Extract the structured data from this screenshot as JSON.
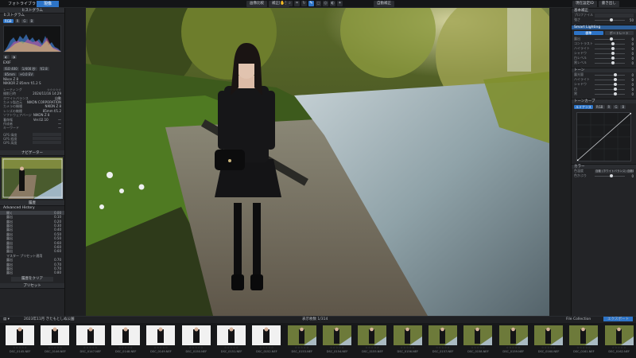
{
  "topbar": {
    "app_tab": "フォトライブラリ",
    "dev_tab": "現像",
    "center_btn_1": "画像比較",
    "center_btn_2": "補正比較",
    "auto_btn": "自動補正",
    "right_btn_1": "現在設定ID",
    "right_btn_2": "書き出し"
  },
  "left": {
    "histogram_title": "ヒストグラム",
    "histogram_sub": "ヒストグラム",
    "channels": [
      "RGB",
      "R",
      "G",
      "B"
    ],
    "exif_title": "EXIF",
    "exif_lines": [
      "ISO 400",
      "1/400 秒",
      "f/2.8",
      "85mm",
      "+0.0 EV"
    ],
    "exif_row": [
      "Nikon Z 8",
      "NIKKOR Z 85mm f/1.2 S"
    ],
    "exif_kv": [
      {
        "k": "レーティング",
        "v": "☆☆☆☆☆"
      },
      {
        "k": "撮影日時",
        "v": "2024/11/16 14:29"
      },
      {
        "k": "ホワイトバランス",
        "v": "自動"
      },
      {
        "k": "カメラ製造元",
        "v": "NIKON CORPORATION"
      },
      {
        "k": "カメラの機種",
        "v": "NIKON Z 8"
      },
      {
        "k": "レンズの機種",
        "v": "85mm f/1.2"
      },
      {
        "k": "ソフトウェアバージョン",
        "v": "NIKON Z 8 Ver.02.10"
      },
      {
        "k": "著作権",
        "v": "—"
      },
      {
        "k": "作成者",
        "v": "—"
      },
      {
        "k": "キーワード",
        "v": "—"
      }
    ],
    "gps_kv": [
      {
        "k": "GPS 緯度",
        "v": ""
      },
      {
        "k": "GPS 経度",
        "v": ""
      },
      {
        "k": "GPS 高度",
        "v": ""
      }
    ],
    "navigator_title": "ナビゲーター",
    "history_title": "履歴",
    "history_sub": "Advanced History",
    "history": [
      {
        "label": "開く",
        "value": "0.00"
      },
      {
        "label": "露出",
        "value": "0.10"
      },
      {
        "label": "露出",
        "value": "0.20"
      },
      {
        "label": "露出",
        "value": "0.30"
      },
      {
        "label": "露出",
        "value": "0.40"
      },
      {
        "label": "露出",
        "value": "0.50"
      },
      {
        "label": "露出",
        "value": "0.50"
      },
      {
        "label": "露出",
        "value": "0.60"
      },
      {
        "label": "露出",
        "value": "0.60"
      },
      {
        "label": "露出",
        "value": "0.60"
      },
      {
        "label": "マスター プリセット適用",
        "value": ""
      },
      {
        "label": "露出",
        "value": "0.70"
      },
      {
        "label": "露出",
        "value": "0.70"
      },
      {
        "label": "露出",
        "value": "0.70"
      },
      {
        "label": "露出",
        "value": "0.80"
      }
    ],
    "history_clear": "履歴をクリア",
    "bottom_title": "プリセット"
  },
  "right": {
    "section_basic": "基本補正",
    "profile_label": "プロファイル",
    "section_blue": "Smart Lighting",
    "tab_a": "標準",
    "tab_b": "ポートレート",
    "sliders_top": [
      {
        "label": "強さ",
        "value": "50",
        "pos": 0.5
      },
      {
        "label": "露出",
        "value": "0",
        "pos": 0.5
      }
    ],
    "sliders_mid": [
      {
        "label": "コントラスト",
        "value": "0",
        "pos": 0.55
      },
      {
        "label": "ハイライト",
        "value": "0",
        "pos": 0.55
      },
      {
        "label": "シャドウ",
        "value": "0",
        "pos": 0.55
      },
      {
        "label": "白レベル",
        "value": "0",
        "pos": 0.55
      },
      {
        "label": "黒レベル",
        "value": "0",
        "pos": 0.55
      }
    ],
    "section_tone": "トーン",
    "sliders_tone": [
      {
        "label": "露光量",
        "value": "0",
        "pos": 0.62
      },
      {
        "label": "ハイライト",
        "value": "0",
        "pos": 0.62
      },
      {
        "label": "シャドウ",
        "value": "0",
        "pos": 0.62
      },
      {
        "label": "白",
        "value": "0",
        "pos": 0.62
      },
      {
        "label": "黒",
        "value": "0",
        "pos": 0.62
      }
    ],
    "curve_title": "トーンカーブ",
    "curve_tabs": [
      "ルミナンス",
      "RGB",
      "R",
      "G",
      "B"
    ],
    "section_color": "カラー",
    "color_rows": [
      {
        "label": "色温度",
        "value": "自動 (ホワイトバランス) 自動補正"
      },
      {
        "label": "色かぶり",
        "value": "0"
      }
    ]
  },
  "filmstrip": {
    "folder": "2023年11月 きたもとしぬ公園",
    "count_label": "表示枚数 1/314",
    "collection_btn": "File Collection",
    "export_btn": "エクスポート",
    "thumbs": [
      "DSC_0145.NEF",
      "DSC_0146.NEF",
      "DSC_0147.NEF",
      "DSC_0148.NEF",
      "DSC_0149.NEF",
      "DSC_0150.NEF",
      "DSC_0151.NEF",
      "DSC_0152.NEF",
      "DSC_0153.NEF",
      "DSC_0154.NEF",
      "DSC_0155.NEF",
      "DSC_0156.NEF",
      "DSC_0157.NEF",
      "DSC_0158.NEF",
      "DSC_0159.NEF",
      "DSC_0160.NEF",
      "DSC_0161.NEF",
      "DSC_0162.NEF"
    ]
  }
}
